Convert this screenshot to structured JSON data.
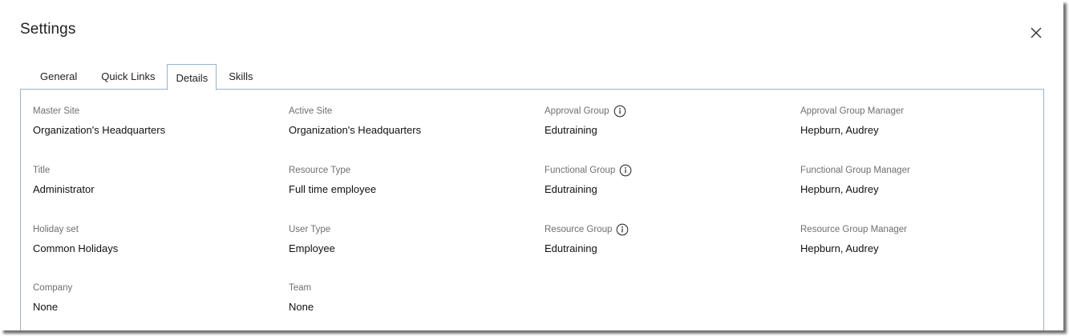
{
  "dialog": {
    "title": "Settings"
  },
  "tabs": [
    {
      "label": "General"
    },
    {
      "label": "Quick Links"
    },
    {
      "label": "Details"
    },
    {
      "label": "Skills"
    }
  ],
  "active_tab": "Details",
  "details": {
    "master_site": {
      "label": "Master Site",
      "value": "Organization's Headquarters"
    },
    "active_site": {
      "label": "Active Site",
      "value": "Organization's Headquarters"
    },
    "approval_group": {
      "label": "Approval Group",
      "value": "Edutraining"
    },
    "approval_group_manager": {
      "label": "Approval Group Manager",
      "value": "Hepburn, Audrey"
    },
    "title": {
      "label": "Title",
      "value": "Administrator"
    },
    "resource_type": {
      "label": "Resource Type",
      "value": "Full time employee"
    },
    "functional_group": {
      "label": "Functional Group",
      "value": "Edutraining"
    },
    "functional_group_manager": {
      "label": "Functional Group Manager",
      "value": "Hepburn, Audrey"
    },
    "holiday_set": {
      "label": "Holiday set",
      "value": "Common Holidays"
    },
    "user_type": {
      "label": "User Type",
      "value": "Employee"
    },
    "resource_group": {
      "label": "Resource Group",
      "value": "Edutraining"
    },
    "resource_group_manager": {
      "label": "Resource Group Manager",
      "value": "Hepburn, Audrey"
    },
    "company": {
      "label": "Company",
      "value": "None"
    },
    "team": {
      "label": "Team",
      "value": "None"
    }
  },
  "icons": {
    "close": "close-icon",
    "info": "info-icon"
  },
  "colors": {
    "panel_border": "#9bb3c8",
    "label_text": "#6f6f6f",
    "value_text": "#111111"
  }
}
